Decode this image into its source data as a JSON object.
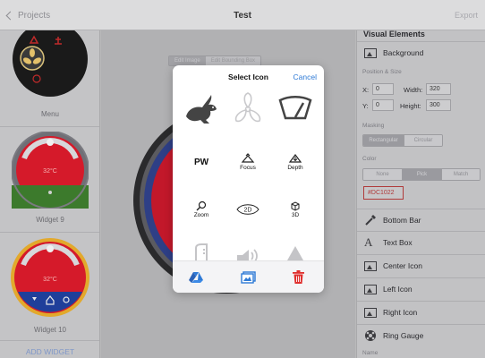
{
  "nav": {
    "back_label": "Projects",
    "title": "Test",
    "export_label": "Export"
  },
  "sidebar": {
    "widgets": [
      {
        "label": "Menu"
      },
      {
        "label": "Widget 9",
        "temp": "32°C"
      },
      {
        "label": "Widget 10",
        "temp": "32°C"
      }
    ],
    "add_label": "ADD WIDGET"
  },
  "canvas": {
    "tabs": [
      "Edit Image",
      "Edit Bounding Box"
    ]
  },
  "modal": {
    "title": "Select Icon",
    "cancel_label": "Cancel",
    "icons": [
      {
        "name": "rabbit-icon",
        "text": ""
      },
      {
        "name": "fan-icon",
        "text": ""
      },
      {
        "name": "wiper-icon",
        "text": ""
      },
      {
        "name": "pw-icon",
        "text": "PW"
      },
      {
        "name": "focus-icon",
        "text": "Focus"
      },
      {
        "name": "depth-icon",
        "text": "Depth"
      },
      {
        "name": "zoom-icon",
        "text": "Zoom"
      },
      {
        "name": "2d-icon",
        "text": "2D"
      },
      {
        "name": "3d-icon",
        "text": "3D"
      }
    ],
    "toolbar": [
      "drive-icon",
      "photos-icon",
      "trash-icon"
    ]
  },
  "panel": {
    "title": "Visual Elements",
    "background_label": "Background",
    "position_caption": "Position & Size",
    "x_label": "X:",
    "x_value": "0",
    "width_label": "Width:",
    "width_value": "320",
    "y_label": "Y:",
    "y_value": "0",
    "height_label": "Height:",
    "height_value": "300",
    "masking_caption": "Masking",
    "masking_options": [
      "Rectangular",
      "Circular"
    ],
    "color_caption": "Color",
    "color_options": [
      "None",
      "Pick",
      "Match"
    ],
    "color_value": "#DC1022",
    "elements": [
      "Bottom Bar",
      "Text Box",
      "Center Icon",
      "Left Icon",
      "Right Icon",
      "Ring Gauge"
    ],
    "name_caption": "Name"
  },
  "colors": {
    "accent": "#2e7ad6",
    "widget_red": "#dc1022",
    "trash": "#e0302f"
  }
}
